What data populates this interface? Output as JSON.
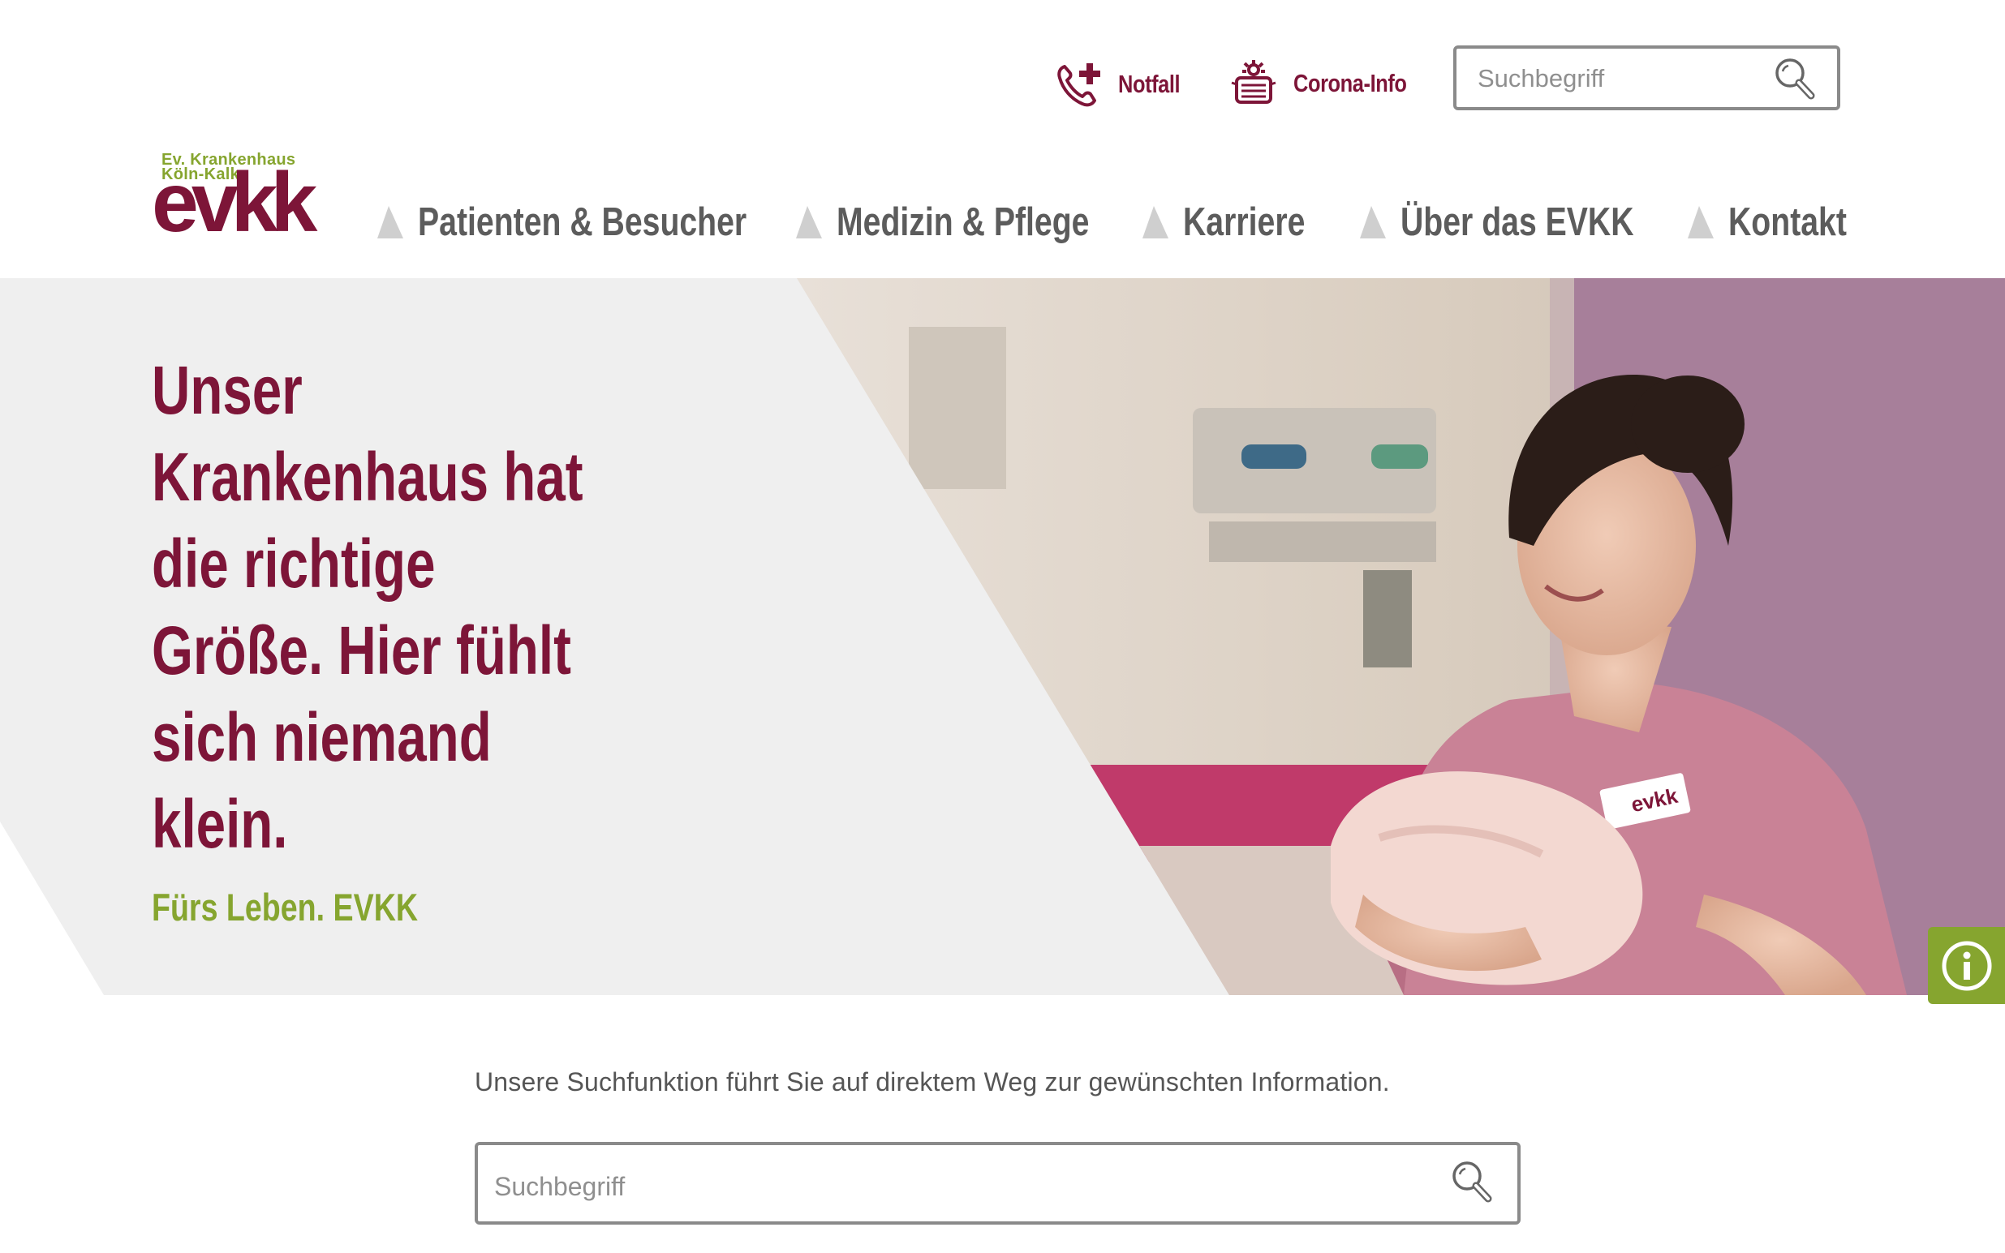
{
  "header": {
    "utility": {
      "emergency_label": "Notfall",
      "corona_label": "Corona-Info",
      "search_placeholder": "Suchbegriff"
    },
    "logo": {
      "line1": "Ev. Krankenhaus",
      "line2": "Köln-Kalk",
      "wordmark": "evkk"
    },
    "nav": [
      {
        "label": "Patienten & Besucher"
      },
      {
        "label": "Medizin & Pflege"
      },
      {
        "label": "Karriere"
      },
      {
        "label": "Über das EVKK"
      },
      {
        "label": "Kontakt"
      }
    ]
  },
  "hero": {
    "title_lines": [
      "Unser",
      "Krankenhaus hat",
      "die richtige",
      "Größe. Hier fühlt",
      "sich niemand",
      "klein."
    ],
    "tagline": "Fürs Leben. EVKK",
    "photo_badge": "evkk"
  },
  "search_section": {
    "intro": "Unsere Suchfunktion führt Sie auf direktem Weg zur gewünschten Information.",
    "placeholder": "Suchbegriff"
  },
  "colors": {
    "brand": "#7d1538",
    "accent_green": "#86a52f",
    "nav_text": "#5c5c5c",
    "hero_bg": "#efefef"
  },
  "icons": [
    "phone-plus-icon",
    "corona-info-icon",
    "search-icon",
    "info-icon",
    "nav-triangle-icon"
  ]
}
